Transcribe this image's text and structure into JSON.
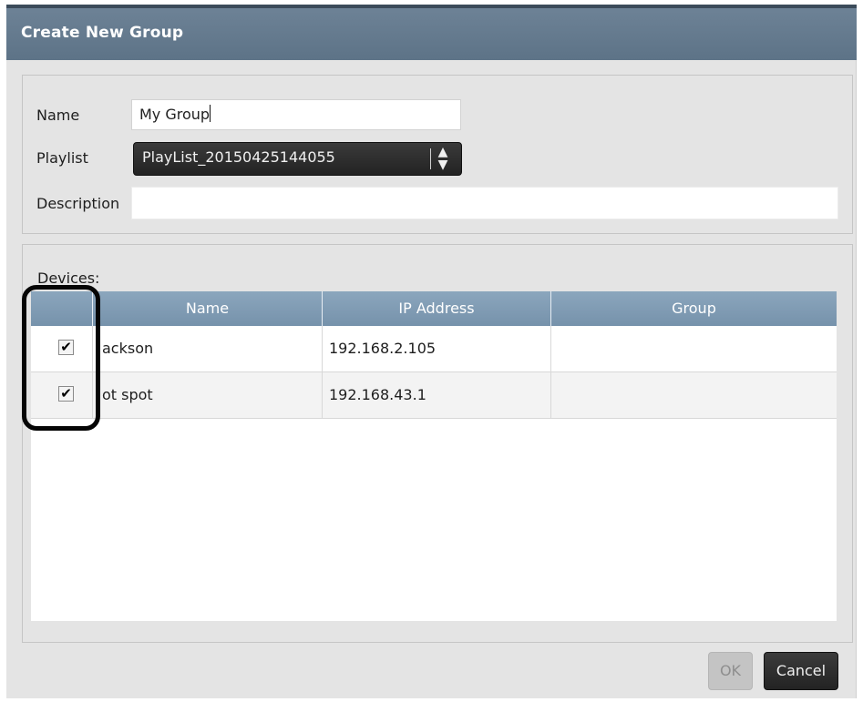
{
  "dialog": {
    "title": "Create New Group"
  },
  "form": {
    "name_label": "Name",
    "name_value": "My Group",
    "playlist_label": "Playlist",
    "playlist_value": "PlayList_20150425144055",
    "description_label": "Description",
    "description_value": ""
  },
  "devices": {
    "label": "Devices:",
    "columns": [
      "",
      "Name",
      "IP Address",
      "Group"
    ],
    "rows": [
      {
        "checked": true,
        "name": "ackson",
        "ip": "192.168.2.105",
        "group": ""
      },
      {
        "checked": true,
        "name": "ot spot",
        "ip": "192.168.43.1",
        "group": ""
      }
    ]
  },
  "buttons": {
    "ok_label": "OK",
    "cancel_label": "Cancel"
  },
  "icons": {
    "check": "✔",
    "updown": "⬍"
  },
  "colors": {
    "titlebar": "#5d7387",
    "table_header": "#7692ab",
    "dark_button": "#2a2a2a"
  }
}
